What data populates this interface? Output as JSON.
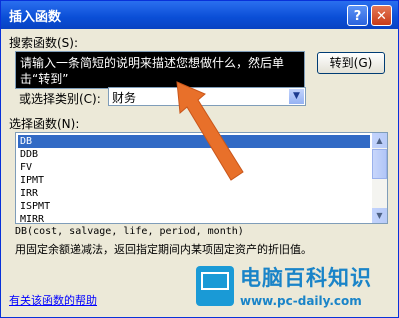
{
  "dialog": {
    "title": "插入函数",
    "help_glyph": "?",
    "close_glyph": "✕"
  },
  "search": {
    "label": "搜索函数(S):",
    "value": "请输入一条简短的说明来描述您想做什么，然后单击“转到”",
    "goto_label": "转到(G)"
  },
  "category": {
    "label": "或选择类别(C):",
    "selected": "财务"
  },
  "functions": {
    "label": "选择函数(N):",
    "items": [
      "DB",
      "DDB",
      "FV",
      "IPMT",
      "IRR",
      "ISPMT",
      "MIRR"
    ],
    "selected_index": 0
  },
  "details": {
    "syntax": "DB(cost, salvage, life, period, month)",
    "description": "用固定余额递减法，返回指定期间内某项固定资产的折旧值。"
  },
  "help_link": "有关该函数的帮助",
  "watermark": {
    "title": "电脑百科知识",
    "url": "www.pc-daily.com"
  },
  "colors": {
    "arrow": "#e8702a",
    "selection": "#316ac5",
    "titlebar": "#0a4ed6"
  }
}
